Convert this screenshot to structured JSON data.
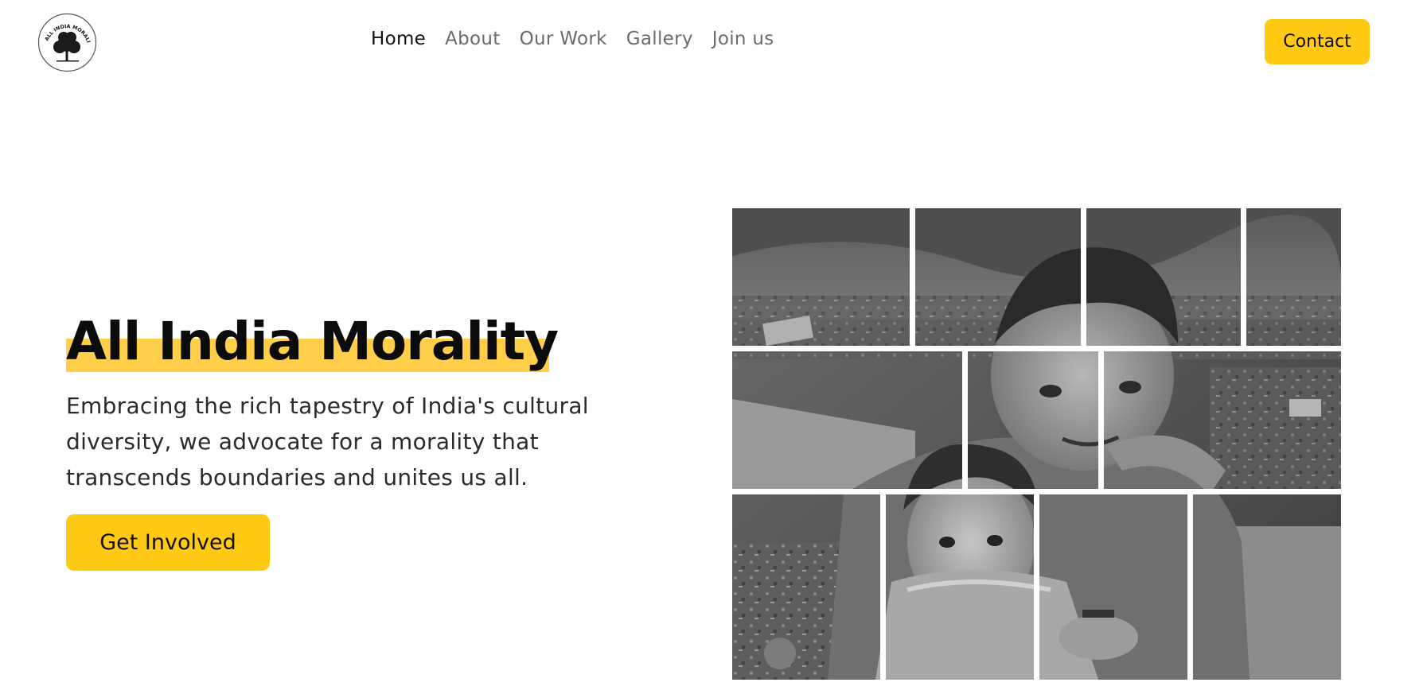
{
  "brand": {
    "logo_text": "ALL INDIA MORALITY"
  },
  "nav": {
    "items": [
      {
        "label": "Home",
        "active": true
      },
      {
        "label": "About",
        "active": false
      },
      {
        "label": "Our Work",
        "active": false
      },
      {
        "label": "Gallery",
        "active": false
      },
      {
        "label": "Join us",
        "active": false
      }
    ],
    "contact_label": "Contact"
  },
  "hero": {
    "title": "All India Morality",
    "text": "Embracing the rich tapestry of India's cultural diversity, we advocate for a morality that transcends boundaries and unites us all.",
    "cta_label": "Get Involved"
  },
  "colors": {
    "accent": "#ffc914",
    "highlight": "#ffcf4a",
    "text_dark": "#0b0b0b",
    "nav_inactive": "#6b6b6b"
  }
}
